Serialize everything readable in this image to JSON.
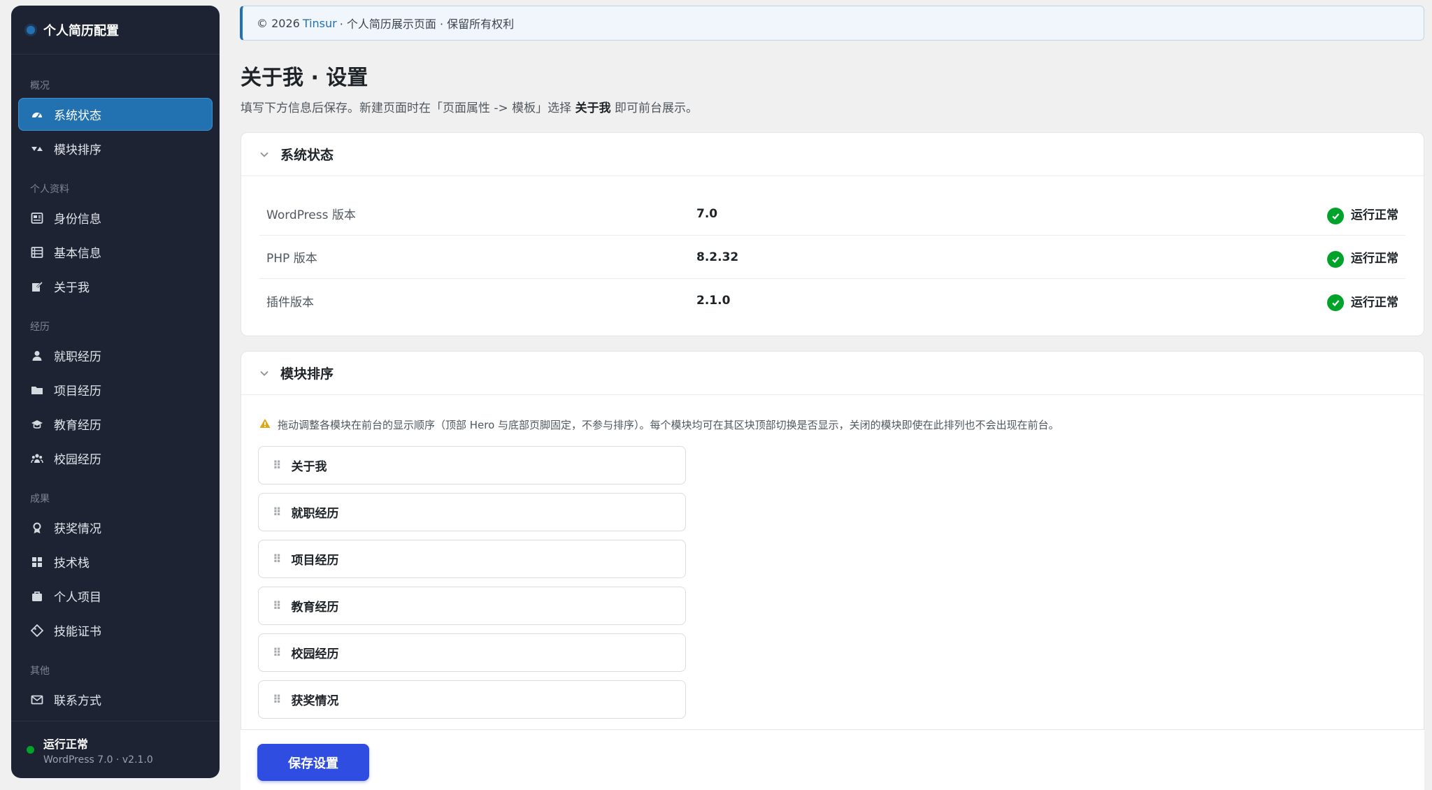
{
  "sidebar": {
    "title": "个人简历配置",
    "groups": [
      {
        "label": "概况"
      },
      {
        "label": "个人资料"
      },
      {
        "label": "经历"
      },
      {
        "label": "成果"
      },
      {
        "label": "其他"
      }
    ],
    "items": [
      {
        "label": "系统状态",
        "icon": "dashboard-icon"
      },
      {
        "label": "模块排序",
        "icon": "sort-icon"
      },
      {
        "label": "身份信息",
        "icon": "id-card-icon"
      },
      {
        "label": "基本信息",
        "icon": "list-icon"
      },
      {
        "label": "关于我",
        "icon": "edit-icon"
      },
      {
        "label": "就职经历",
        "icon": "user-icon"
      },
      {
        "label": "项目经历",
        "icon": "folder-icon"
      },
      {
        "label": "教育经历",
        "icon": "graduation-cap-icon"
      },
      {
        "label": "校园经历",
        "icon": "group-icon"
      },
      {
        "label": "获奖情况",
        "icon": "award-icon"
      },
      {
        "label": "技术栈",
        "icon": "grid-icon"
      },
      {
        "label": "个人项目",
        "icon": "briefcase-icon"
      },
      {
        "label": "技能证书",
        "icon": "certificate-icon"
      },
      {
        "label": "联系方式",
        "icon": "mail-icon"
      }
    ],
    "footer": {
      "status": "运行正常",
      "version": "WordPress 7.0 · v2.1.0"
    }
  },
  "notice": {
    "prefix": "© 2026",
    "link": "Tinsur",
    "suffix": "· 个人简历展示页面 · 保留所有权利"
  },
  "page": {
    "title": "关于我 · 设置",
    "desc_before": "填写下方信息后保存。新建页面时在「页面属性 -> 模板」选择",
    "desc_bold": "关于我",
    "desc_after": "即可前台展示。"
  },
  "status_card": {
    "title": "系统状态",
    "rows": [
      {
        "label": "WordPress 版本",
        "value": "7.0",
        "status": "运行正常"
      },
      {
        "label": "PHP 版本",
        "value": "8.2.32",
        "status": "运行正常"
      },
      {
        "label": "插件版本",
        "value": "2.1.0",
        "status": "运行正常"
      }
    ]
  },
  "order_card": {
    "title": "模块排序",
    "note": "拖动调整各模块在前台的显示顺序（顶部 Hero 与底部页脚固定，不参与排序）。每个模块均可在其区块顶部切换是否显示，关闭的模块即使在此排列也不会出现在前台。",
    "modules": [
      "关于我",
      "就职经历",
      "项目经历",
      "教育经历",
      "校园经历",
      "获奖情况"
    ]
  },
  "actions": {
    "save_label": "保存设置"
  },
  "colors": {
    "accent": "#2271b1",
    "sidebar_bg": "#1d2332",
    "success": "#00a32a",
    "save_button": "#2f4de0"
  }
}
